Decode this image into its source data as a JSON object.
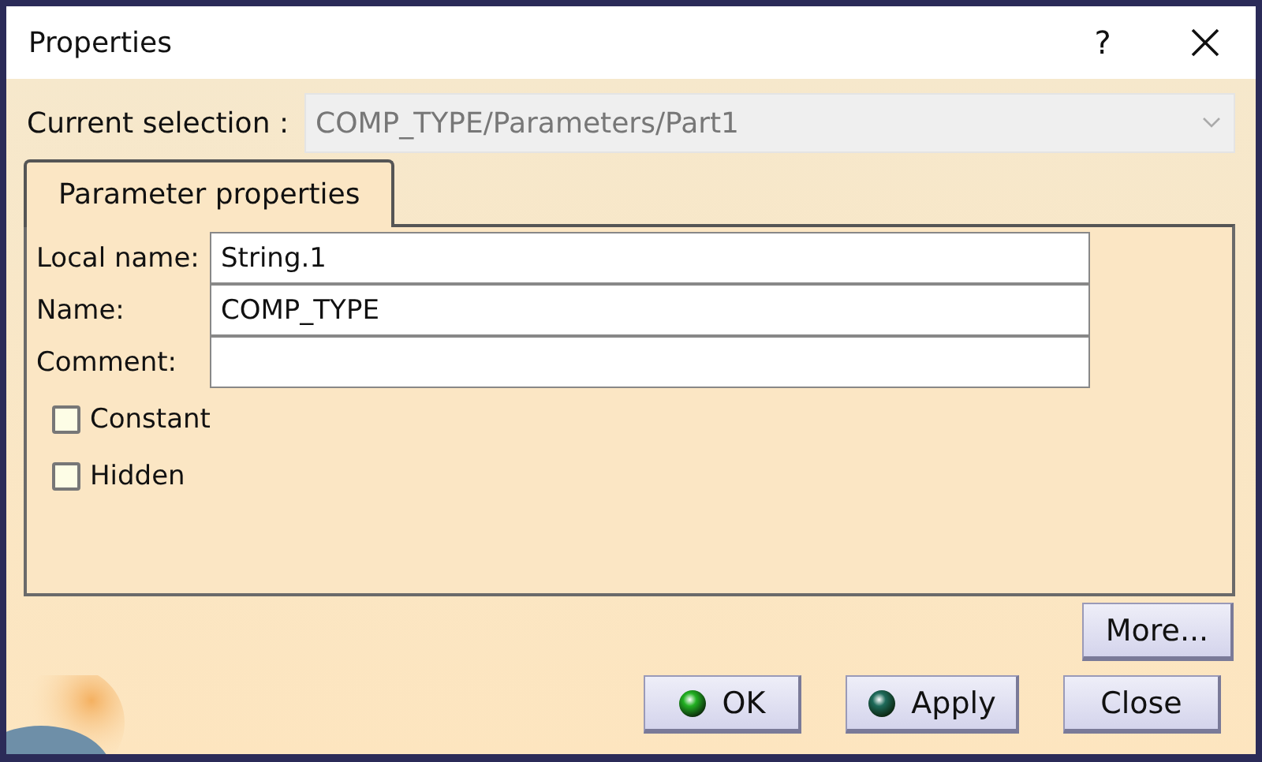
{
  "window": {
    "title": "Properties",
    "help": "?"
  },
  "current_selection": {
    "label": "Current selection :",
    "value": "COMP_TYPE/Parameters/Part1",
    "disabled": true
  },
  "tabs": [
    {
      "label": "Parameter properties",
      "selected": true
    }
  ],
  "fields": [
    {
      "label": "Local name:",
      "value": "String.1"
    },
    {
      "label": "Name:",
      "value": "COMP_TYPE"
    },
    {
      "label": "Comment:"
    }
  ],
  "checkboxes": [
    {
      "label": "Constant",
      "checked": false
    },
    {
      "label": "Hidden",
      "checked": false
    }
  ],
  "more_button": {
    "label": "More..."
  },
  "buttons": [
    {
      "label": "OK",
      "kind": "ok"
    },
    {
      "label": "Apply",
      "kind": "apply"
    },
    {
      "label": "Close",
      "kind": "plain"
    }
  ]
}
